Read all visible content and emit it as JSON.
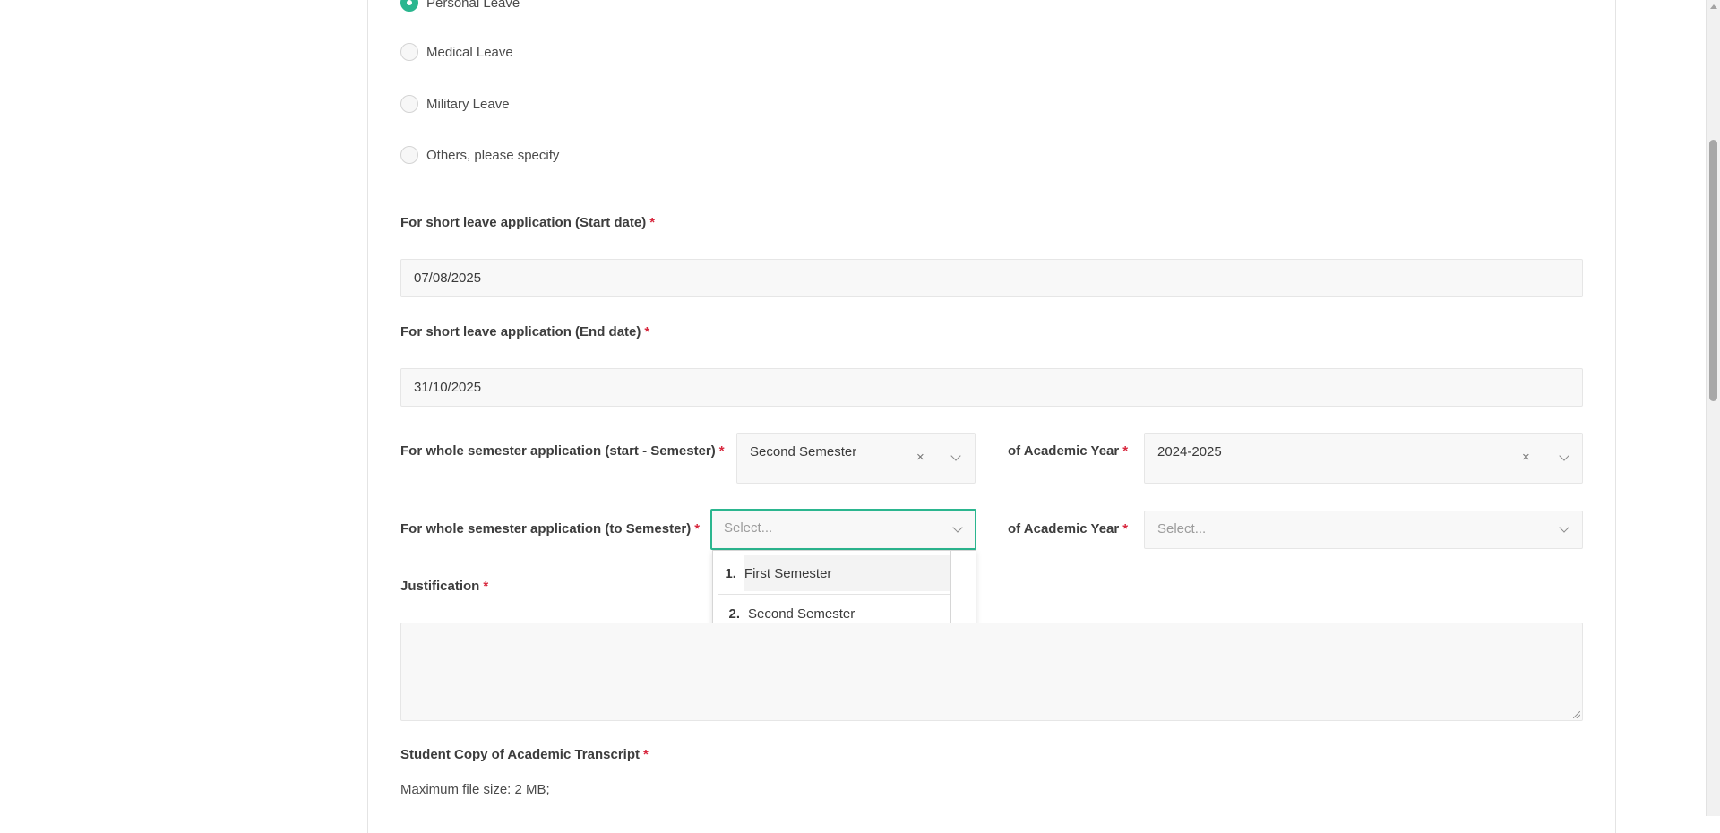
{
  "leave_types": [
    {
      "label": "Personal Leave",
      "checked": true
    },
    {
      "label": "Medical Leave",
      "checked": false
    },
    {
      "label": "Military Leave",
      "checked": false
    },
    {
      "label": "Others, please specify",
      "checked": false
    }
  ],
  "start_date": {
    "label": "For short leave application (Start date)",
    "required": "*",
    "value": "07/08/2025"
  },
  "end_date": {
    "label": "For short leave application (End date)",
    "required": "*",
    "value": "31/10/2025"
  },
  "start_semester": {
    "label": "For whole semester application (start - Semester)",
    "required": "*",
    "value": "Second Semester",
    "clear": "×",
    "year_label": "of Academic Year",
    "year_required": "*",
    "year_value": "2024-2025",
    "year_clear": "×"
  },
  "to_semester": {
    "label": "For whole semester application (to Semester)",
    "required": "*",
    "placeholder": "Select...",
    "year_label": "of Academic Year",
    "year_required": "*",
    "year_placeholder": "Select..."
  },
  "semester_options": [
    {
      "num": "1.",
      "label": "First Semester"
    },
    {
      "num": "2.",
      "label": "Second Semester"
    }
  ],
  "justification": {
    "label": "Justification",
    "required": "*"
  },
  "transcript": {
    "label": "Student Copy of Academic Transcript",
    "required": "*",
    "hint": "Maximum file size: 2 MB;"
  },
  "colors": {
    "accent": "#2bb68f",
    "required": "#d8283e"
  }
}
